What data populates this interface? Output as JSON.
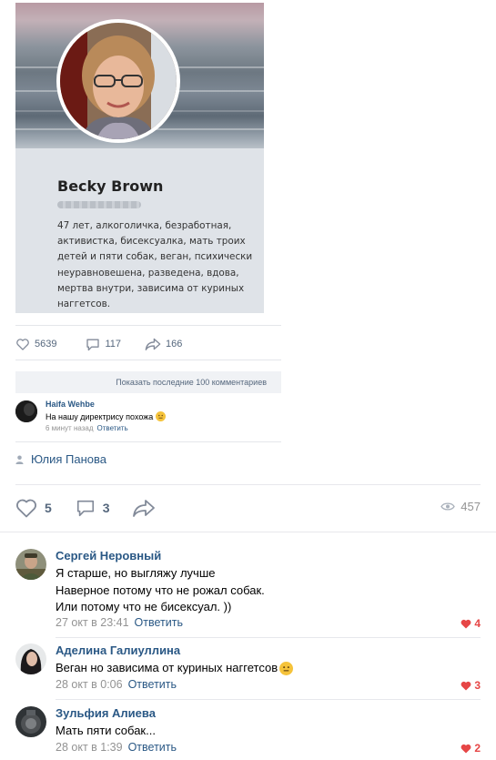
{
  "profile_card": {
    "name": "Becky Brown",
    "bio": "47 лет, алкоголичка, безработная, активистка, бисексуалка, мать троих детей и пяти собак, веган, психически неуравновешена, разведена, вдова, мертва внутри, зависима от куриных наггетсов."
  },
  "embedded_post": {
    "likes": "5639",
    "comments": "117",
    "shares": "166",
    "show_more": "Показать последние 100 комментариев",
    "comment": {
      "author": "Haifa Wehbe",
      "text": "На нашу директрису похожа",
      "time": "6 минут назад",
      "reply": "Ответить"
    }
  },
  "signer": "Юлия Панова",
  "post_actions": {
    "likes": "5",
    "comments": "3",
    "views": "457"
  },
  "comments": [
    {
      "author": "Сергей Неровный",
      "lines": [
        "Я старше, но выгляжу лучше",
        "Наверное потому что не рожал собак.",
        "Или потому что не бисексуал. ))"
      ],
      "time": "27 окт в 23:41",
      "reply": "Ответить",
      "likes": "4"
    },
    {
      "author": "Аделина Галиуллина",
      "lines": [
        "Веган но зависима от куриных наггетсов"
      ],
      "time": "28 окт в 0:06",
      "reply": "Ответить",
      "likes": "3"
    },
    {
      "author": "Зульфия Алиева",
      "lines": [
        "Мать пяти собак..."
      ],
      "time": "28 окт в 1:39",
      "reply": "Ответить",
      "likes": "2"
    }
  ],
  "colors": {
    "link": "#2a5885",
    "muted": "#939393",
    "action": "#55677d",
    "like_red": "#e64646"
  },
  "icons": [
    "heart-icon",
    "comment-icon",
    "share-icon",
    "eye-icon",
    "user-icon",
    "smile-emoji-icon"
  ]
}
